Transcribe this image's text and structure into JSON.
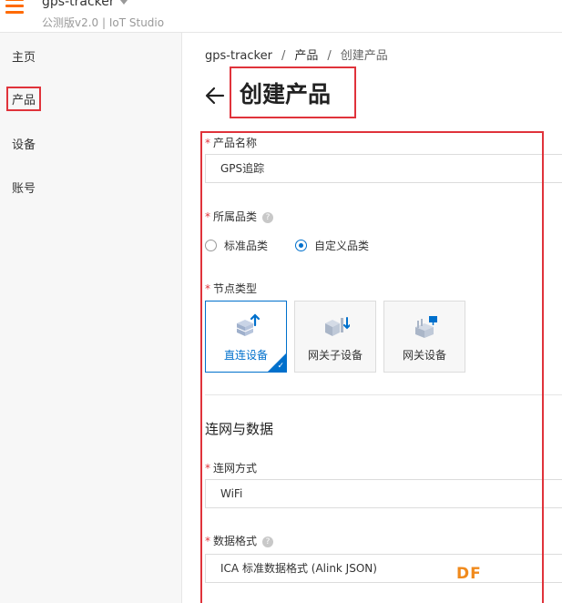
{
  "header": {
    "app_name": "gps-tracker",
    "app_subtitle": "公测版v2.0 | IoT Studio"
  },
  "sidebar": {
    "items": [
      {
        "label": "主页"
      },
      {
        "label": "产品"
      },
      {
        "label": "设备"
      },
      {
        "label": "账号"
      }
    ]
  },
  "breadcrumb": {
    "items": [
      "gps-tracker",
      "产品",
      "创建产品"
    ],
    "separator": "/"
  },
  "page": {
    "title": "创建产品"
  },
  "form": {
    "product_name": {
      "label": "产品名称",
      "value": "GPS追踪"
    },
    "category": {
      "label": "所属品类",
      "options": [
        "标准品类",
        "自定义品类"
      ],
      "selected": "自定义品类"
    },
    "node_type": {
      "label": "节点类型",
      "options": [
        "直连设备",
        "网关子设备",
        "网关设备"
      ],
      "selected": "直连设备"
    },
    "section_title": "连网与数据",
    "network": {
      "label": "连网方式",
      "value": "WiFi"
    },
    "data_format": {
      "label": "数据格式",
      "value": "ICA 标准数据格式 (Alink JSON)"
    },
    "required_mark": "*"
  },
  "watermark": {
    "text": "DF"
  },
  "colors": {
    "accent": "#0070cc",
    "brand": "#ff6a00",
    "highlight_box": "#e0333b"
  },
  "icons": {
    "menu": "hamburger-icon",
    "back": "arrow-left-icon",
    "help": "question-circle-icon"
  }
}
